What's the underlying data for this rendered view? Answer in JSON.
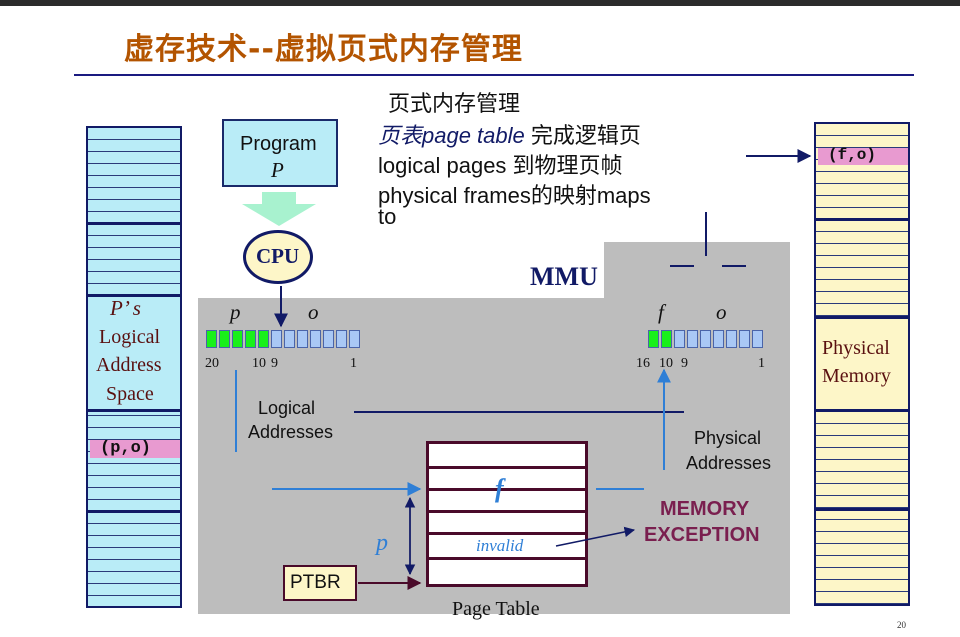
{
  "title": "虚存技术--虚拟页式内存管理",
  "description": {
    "heading": "页式内存管理",
    "line1_italic": "页表page table",
    "line1_rest": " 完成逻辑页",
    "line2": "logical pages 到物理页帧",
    "line3": "physical frames的映射maps",
    "line4": "to"
  },
  "program": {
    "line1": "Program",
    "line2": "P"
  },
  "cpu": "CPU",
  "mmu": "MMU",
  "logical_space": {
    "line1": "P’ s",
    "line2": "Logical",
    "line3": "Address",
    "line4": "Space",
    "entry": "(p,o)"
  },
  "physical_memory": {
    "line1": "Physical",
    "line2": "Memory",
    "entry": "(f,o)"
  },
  "logical_address": {
    "p": "p",
    "o": "o",
    "bit_left": "20",
    "bit_mid": "10",
    "bit_mid2": "9",
    "bit_right": "1",
    "label1": "Logical",
    "label2": "Addresses"
  },
  "physical_address": {
    "f": "f",
    "o": "o",
    "bit_left": "16",
    "bit_mid": "10",
    "bit_mid2": "9",
    "bit_right": "1",
    "label1": "Physical",
    "label2": "Addresses"
  },
  "page_table": {
    "f": "f",
    "invalid": "invalid",
    "caption": "Page Table",
    "index": "p"
  },
  "ptbr": "PTBR",
  "exception": {
    "line1": "MEMORY",
    "line2": "EXCEPTION"
  },
  "slide_number": "20",
  "colors": {
    "title": "#b35400",
    "navy": "#111a66",
    "arrow": "#2f7fd6",
    "exception": "#7a1f4f",
    "cyan": "#b9ecf7",
    "yellow": "#fdf6c8",
    "green": "#19f01a"
  }
}
